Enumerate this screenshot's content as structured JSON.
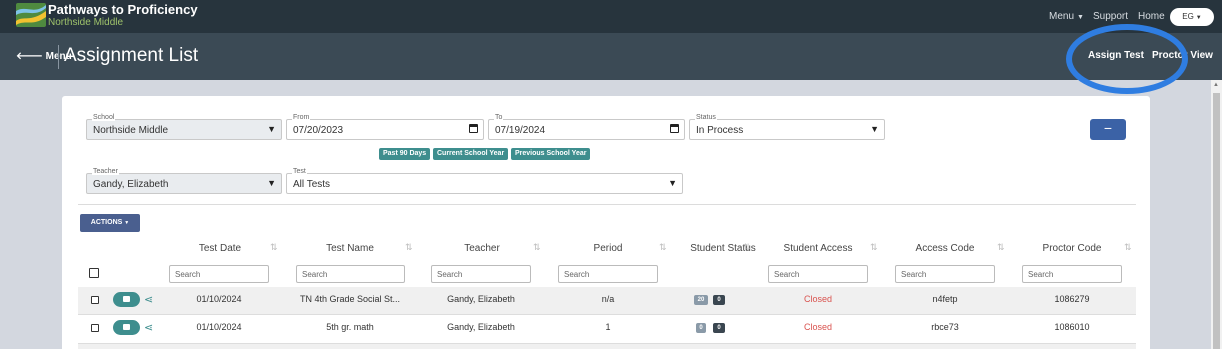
{
  "app": {
    "title": "Pathways to Proficiency",
    "school_subtitle": "Northside Middle"
  },
  "topnav": {
    "menu": "Menu",
    "support": "Support",
    "home": "Home",
    "user_initials": "EG"
  },
  "subbar": {
    "menu_back": "Menu",
    "page_title": "Assignment List",
    "assign_test": "Assign Test",
    "proctor_view": "Proctor View"
  },
  "filters": {
    "school": {
      "label": "School",
      "value": "Northside Middle"
    },
    "from": {
      "label": "From",
      "value": "07/20/2023"
    },
    "to": {
      "label": "To",
      "value": "07/19/2024"
    },
    "status": {
      "label": "Status",
      "value": "In Process"
    },
    "teacher": {
      "label": "Teacher",
      "value": "Gandy, Elizabeth"
    },
    "test": {
      "label": "Test",
      "value": "All Tests"
    },
    "quick_ranges": [
      "Past 90 Days",
      "Current School Year",
      "Previous School Year"
    ],
    "collapse": "−"
  },
  "actions": {
    "label": "ACTIONS"
  },
  "table": {
    "columns": [
      "Test Date",
      "Test Name",
      "Teacher",
      "Period",
      "Student Status",
      "Student Access",
      "Access Code",
      "Proctor Code"
    ],
    "search_placeholder": "Search",
    "rows": [
      {
        "date": "01/10/2024",
        "name": "TN 4th Grade Social St...",
        "teacher": "Gandy, Elizabeth",
        "period": "n/a",
        "status_a": "20",
        "status_b": "0",
        "access": "Closed",
        "access_code": "n4fetp",
        "proctor_code": "1086279"
      },
      {
        "date": "01/10/2024",
        "name": "5th gr. math",
        "teacher": "Gandy, Elizabeth",
        "period": "1",
        "status_a": "0",
        "status_b": "0",
        "access": "Closed",
        "access_code": "rbce73",
        "proctor_code": "1086010"
      }
    ]
  },
  "colors": {
    "topbar": "#27343d",
    "subbar": "#3b4a55",
    "teal": "#3e8e8e",
    "blue": "#3b62a6",
    "closed": "#d9534f",
    "highlight": "#2f7de1"
  },
  "icons": [
    "logo-icon",
    "chevron-down-icon",
    "arrow-left-icon",
    "calendar-icon",
    "folder-icon",
    "share-icon",
    "sort-icon"
  ]
}
